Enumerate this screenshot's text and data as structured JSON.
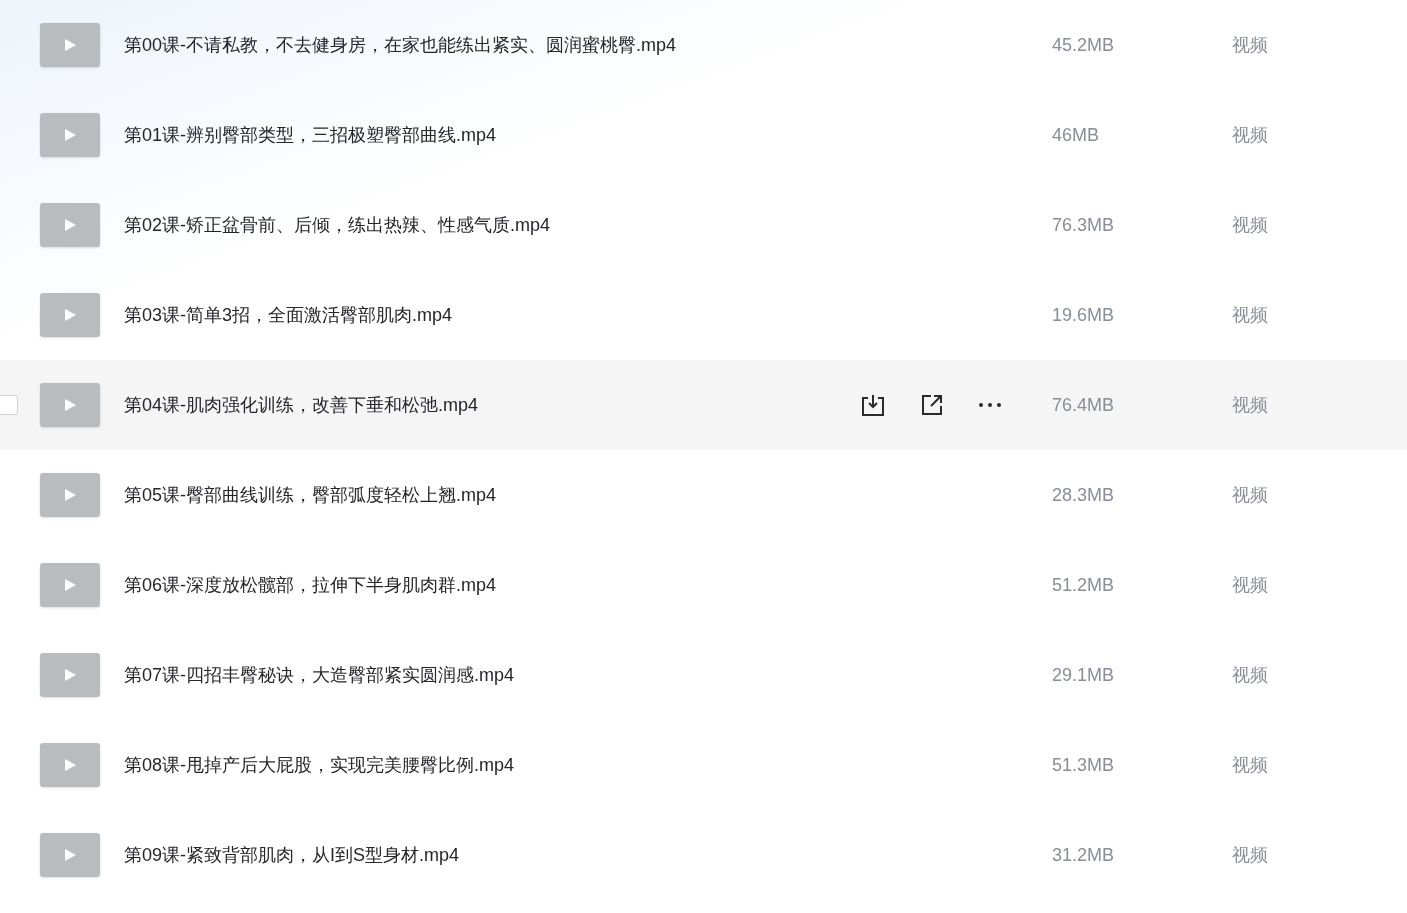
{
  "files": [
    {
      "name": "第00课-不请私教，不去健身房，在家也能练出紧实、圆润蜜桃臀.mp4",
      "size": "45.2MB",
      "type": "视频",
      "hovered": false
    },
    {
      "name": "第01课-辨别臀部类型，三招极塑臀部曲线.mp4",
      "size": "46MB",
      "type": "视频",
      "hovered": false
    },
    {
      "name": "第02课-矫正盆骨前、后倾，练出热辣、性感气质.mp4",
      "size": "76.3MB",
      "type": "视频",
      "hovered": false
    },
    {
      "name": "第03课-简单3招，全面激活臀部肌肉.mp4",
      "size": "19.6MB",
      "type": "视频",
      "hovered": false
    },
    {
      "name": "第04课-肌肉强化训练，改善下垂和松弛.mp4",
      "size": "76.4MB",
      "type": "视频",
      "hovered": true,
      "checked": false
    },
    {
      "name": "第05课-臀部曲线训练，臀部弧度轻松上翘.mp4",
      "size": "28.3MB",
      "type": "视频",
      "hovered": false
    },
    {
      "name": "第06课-深度放松髋部，拉伸下半身肌肉群.mp4",
      "size": "51.2MB",
      "type": "视频",
      "hovered": false
    },
    {
      "name": "第07课-四招丰臀秘诀，大造臀部紧实圆润感.mp4",
      "size": "29.1MB",
      "type": "视频",
      "hovered": false
    },
    {
      "name": "第08课-甩掉产后大屁股，实现完美腰臀比例.mp4",
      "size": "51.3MB",
      "type": "视频",
      "hovered": false
    },
    {
      "name": "第09课-紧致背部肌肉，从I到S型身材.mp4",
      "size": "31.2MB",
      "type": "视频",
      "hovered": false
    }
  ]
}
